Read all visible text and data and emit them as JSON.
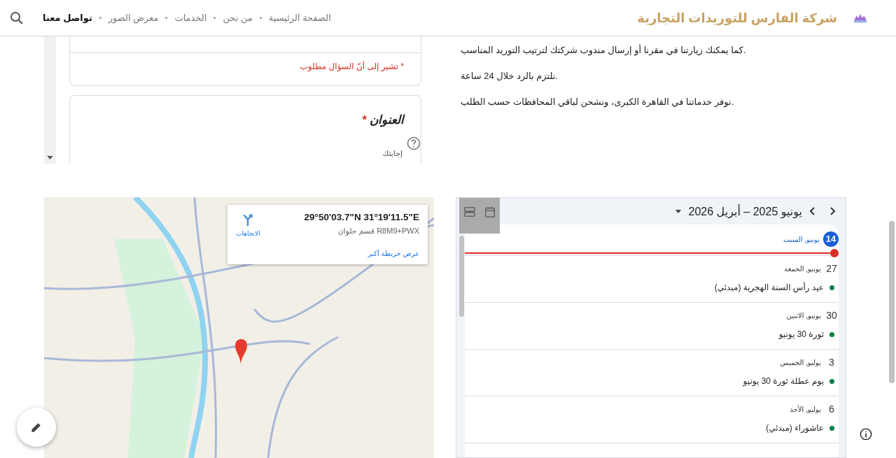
{
  "header": {
    "title": "شركة الفارس للتوريدات التجارية",
    "nav": [
      {
        "label": "الصفحة الرئيسية",
        "selected": false
      },
      {
        "label": "من نحن",
        "selected": false
      },
      {
        "label": "الخدمات",
        "selected": false
      },
      {
        "label": "معرض الصور",
        "selected": false
      },
      {
        "label": "تواصل معنا",
        "selected": true
      }
    ]
  },
  "form": {
    "required_note": "* تشير إلى أنّ السؤال مطلوب",
    "question": {
      "title": "العنوان",
      "required_mark": "*",
      "placeholder": "إجابتك"
    }
  },
  "info_paragraphs": [
    "كما يمكنك زيارتنا في مقرنا أو إرسال مندوب شركتك لترتيب التوريد المناسب.",
    "نلتزم بالرد خلال 24 ساعة.",
    "نوفر خدماتنا في القاهرة الكبرى، ونشحن لباقي المحافظات حسب الطلب."
  ],
  "map": {
    "coordinates": "29°50'03.7\"N 31°19'11.5\"E",
    "plus_code": "R8M9+PWX قسم حلوان",
    "directions": "الاتجاهات",
    "larger_map_link": "عرض خريطة أكبر"
  },
  "calendar": {
    "range": "يونيو 2025 – أبريل 2026",
    "days": [
      {
        "day": "14",
        "label": "يونيو, السبت",
        "today": true
      },
      {
        "day": "27",
        "label": "يونيو, الجمعة",
        "today": false,
        "events": [
          {
            "title": "عيد رأس السنة الهجرية (مبدئي)",
            "color": "#0b8043"
          }
        ]
      },
      {
        "day": "30",
        "label": "يونيو, الاثنين",
        "today": false,
        "events": [
          {
            "title": "ثورة 30 يونيو",
            "color": "#0b8043"
          }
        ]
      },
      {
        "day": "3",
        "label": "يوليو, الخميس",
        "today": false,
        "events": [
          {
            "title": "يوم عطلة ثورة 30 يونيو",
            "color": "#0b8043"
          }
        ]
      },
      {
        "day": "6",
        "label": "يوليو, الأحد",
        "today": false,
        "events": [
          {
            "title": "عاشوراء (مبدئي)",
            "color": "#0b8043"
          }
        ]
      }
    ]
  }
}
